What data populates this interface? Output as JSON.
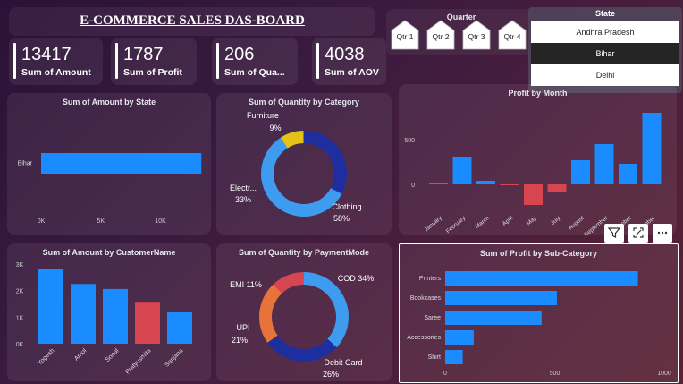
{
  "header": {
    "title": "E-COMMERCE SALES DAS-BOARD"
  },
  "kpis": [
    {
      "value": "13417",
      "label": "Sum of Amount"
    },
    {
      "value": "1787",
      "label": "Sum of Profit"
    },
    {
      "value": "206",
      "label": "Sum of Qua..."
    },
    {
      "value": "4038",
      "label": "Sum of AOV"
    }
  ],
  "quarter": {
    "title": "Quarter",
    "options": [
      "Qtr 1",
      "Qtr 2",
      "Qtr 3",
      "Qtr 4"
    ]
  },
  "state": {
    "title": "State",
    "options": [
      "Andhra Pradesh",
      "Bihar",
      "Delhi"
    ],
    "selected": "Bihar"
  },
  "visual_tools": {
    "filter_icon": "filter-icon",
    "expand_icon": "focus-mode-icon",
    "more_icon": "more-options-icon"
  },
  "colors": {
    "blue": "#1a8cff",
    "red": "#d64550",
    "navy": "#1f2e9e",
    "orange": "#e8733a",
    "yellow": "#e6c117",
    "light_blue": "#3d9bf0"
  },
  "charts": {
    "amount_by_state": {
      "title": "Sum of Amount by State",
      "ticks": [
        "0K",
        "5K",
        "10K"
      ]
    },
    "qty_by_category": {
      "title": "Sum of Quantity by Category",
      "labels": [
        {
          "name": "Furniture",
          "pct": "9%"
        },
        {
          "name": "Electr...",
          "pct": "33%"
        },
        {
          "name": "Clothing",
          "pct": "58%"
        }
      ]
    },
    "profit_by_month": {
      "title": "Profit by Month",
      "yticks": [
        "500",
        "0"
      ]
    },
    "amount_by_customer": {
      "title": "Sum of Amount by CustomerName",
      "yticks": [
        "3K",
        "2K",
        "1K",
        "0K"
      ]
    },
    "qty_by_payment": {
      "title": "Sum of Quantity by PaymentMode",
      "labels": [
        {
          "name": "COD",
          "pct": "34%",
          "text": "COD 34%"
        },
        {
          "name": "Debit Card",
          "pct": "26%"
        },
        {
          "name": "UPI",
          "pct": "21%"
        },
        {
          "name": "EMI",
          "pct": "11%",
          "text": "EMI 11%"
        }
      ]
    },
    "profit_by_subcategory": {
      "title": "Sum of Profit by Sub-Category",
      "xticks": [
        "0",
        "500",
        "1000"
      ]
    }
  },
  "chart_data": [
    {
      "type": "bar",
      "orientation": "horizontal",
      "title": "Sum of Amount by State",
      "categories": [
        "Bihar"
      ],
      "values": [
        13417
      ],
      "xlim": [
        0,
        13700
      ]
    },
    {
      "type": "pie",
      "donut": true,
      "title": "Sum of Quantity by Category",
      "categories": [
        "Furniture",
        "Electronics",
        "Clothing"
      ],
      "values": [
        9,
        33,
        58
      ],
      "colors": [
        "#e6c117",
        "#1f2e9e",
        "#3d9bf0"
      ]
    },
    {
      "type": "bar",
      "title": "Profit by Month",
      "categories": [
        "January",
        "February",
        "March",
        "April",
        "May",
        "July",
        "August",
        "September",
        "October",
        "November"
      ],
      "values": [
        20,
        310,
        40,
        -10,
        -230,
        -80,
        270,
        450,
        230,
        800
      ],
      "colors": [
        "#1a8cff",
        "#1a8cff",
        "#1a8cff",
        "#d64550",
        "#d64550",
        "#d64550",
        "#1a8cff",
        "#1a8cff",
        "#1a8cff",
        "#1a8cff"
      ],
      "ylim": [
        -300,
        900
      ]
    },
    {
      "type": "bar",
      "title": "Sum of Amount by CustomerName",
      "categories": [
        "Yogesh",
        "Amol",
        "Sonal",
        "Pratyusmita",
        "Sanjana"
      ],
      "values": [
        2830,
        2250,
        2060,
        1580,
        1180
      ],
      "colors": [
        "#1a8cff",
        "#1a8cff",
        "#1a8cff",
        "#d64550",
        "#1a8cff"
      ],
      "ylim": [
        0,
        3000
      ]
    },
    {
      "type": "pie",
      "donut": true,
      "title": "Sum of Quantity by PaymentMode",
      "categories": [
        "COD",
        "Debit Card",
        "UPI",
        "EMI"
      ],
      "values": [
        34,
        26,
        21,
        11
      ],
      "colors": [
        "#3d9bf0",
        "#1f2e9e",
        "#e8733a",
        "#d64550"
      ]
    },
    {
      "type": "bar",
      "orientation": "horizontal",
      "title": "Sum of Profit by Sub-Category",
      "categories": [
        "Printers",
        "Bookcases",
        "Saree",
        "Accessories",
        "Shirt"
      ],
      "values": [
        880,
        510,
        440,
        130,
        80
      ],
      "xlim": [
        0,
        1000
      ]
    }
  ]
}
